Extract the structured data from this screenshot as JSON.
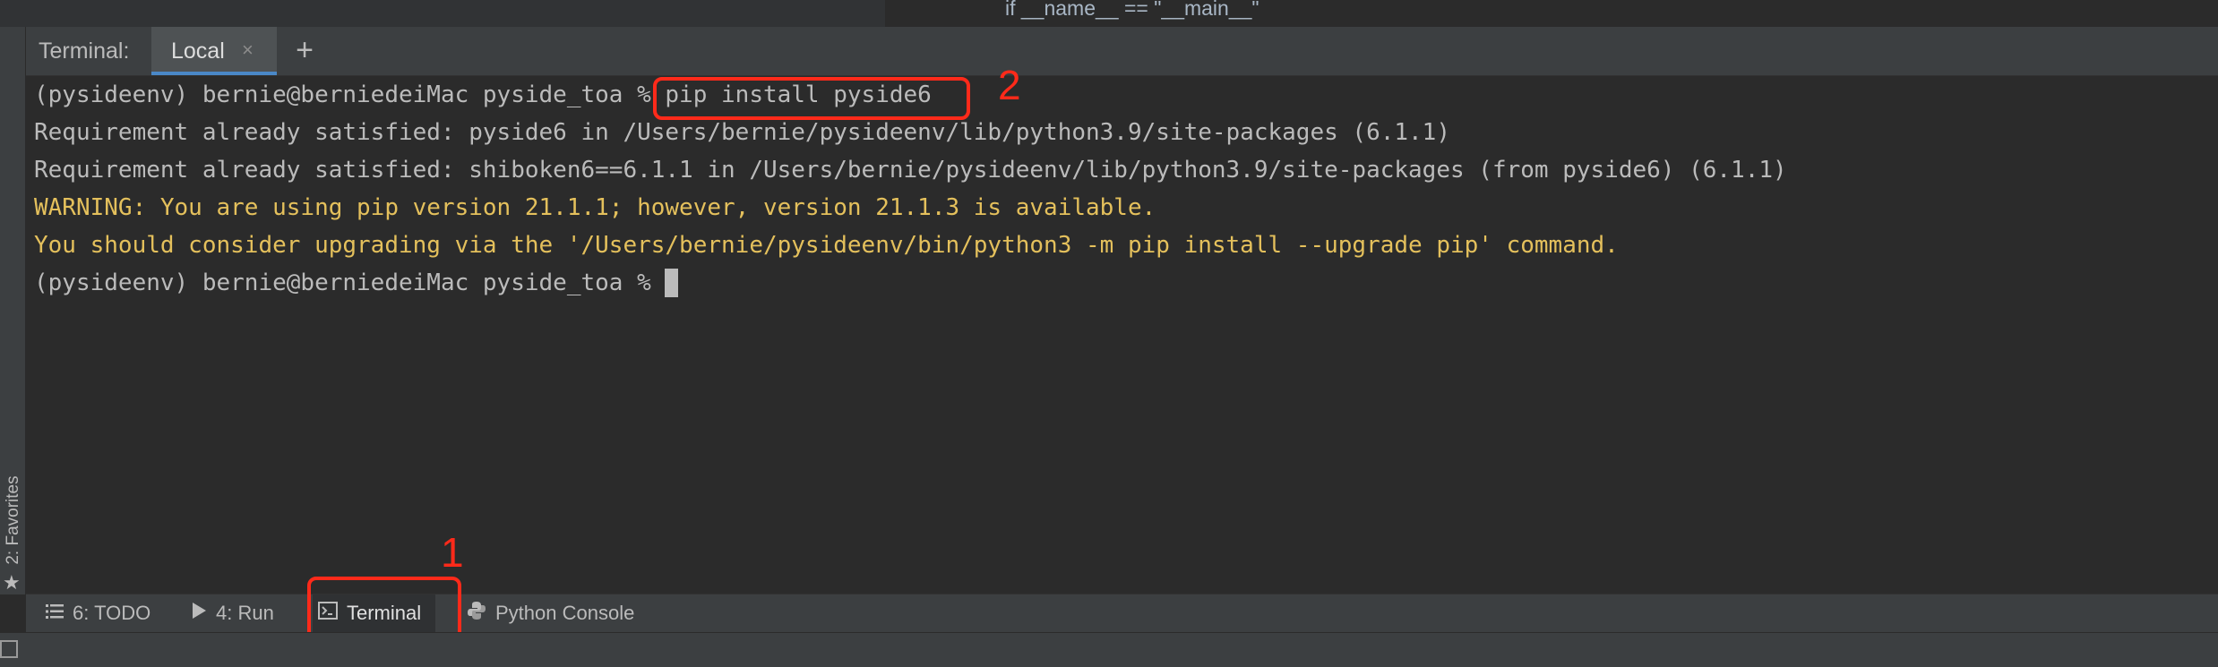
{
  "editor": {
    "code_snippet": "if __name__ == \"__main__\""
  },
  "sidebar": {
    "favorites_label": "2: Favorites",
    "favorites_icon": "star-icon"
  },
  "terminal": {
    "title": "Terminal:",
    "tabs": [
      {
        "label": "Local",
        "close": "×"
      }
    ],
    "add_tab": "+",
    "lines": [
      {
        "text": "(pysideenv) bernie@berniedeiMac pyside_toa % pip install pyside6",
        "type": "prompt"
      },
      {
        "text": "Requirement already satisfied: pyside6 in /Users/bernie/pysideenv/lib/python3.9/site-packages (6.1.1)",
        "type": "output"
      },
      {
        "text": "Requirement already satisfied: shiboken6==6.1.1 in /Users/bernie/pysideenv/lib/python3.9/site-packages (from pyside6) (6.1.1)",
        "type": "output"
      },
      {
        "text": "WARNING: You are using pip version 21.1.1; however, version 21.1.3 is available.",
        "type": "warning"
      },
      {
        "text": "You should consider upgrading via the '/Users/bernie/pysideenv/bin/python3 -m pip install --upgrade pip' command.",
        "type": "warning"
      },
      {
        "text": "(pysideenv) bernie@berniedeiMac pyside_toa % ",
        "type": "prompt"
      }
    ]
  },
  "annotations": [
    {
      "label": "1"
    },
    {
      "label": "2"
    }
  ],
  "bottom_tabs": [
    {
      "label": "6: TODO",
      "icon": "list-icon"
    },
    {
      "label": "4: Run",
      "icon": "play-icon"
    },
    {
      "label": "Terminal",
      "icon": "terminal-icon",
      "active": true
    },
    {
      "label": "Python Console",
      "icon": "python-icon"
    }
  ],
  "colors": {
    "annotation": "#ff2a1a",
    "warning_text": "#e4c05c",
    "tab_underline": "#4a88c7"
  }
}
